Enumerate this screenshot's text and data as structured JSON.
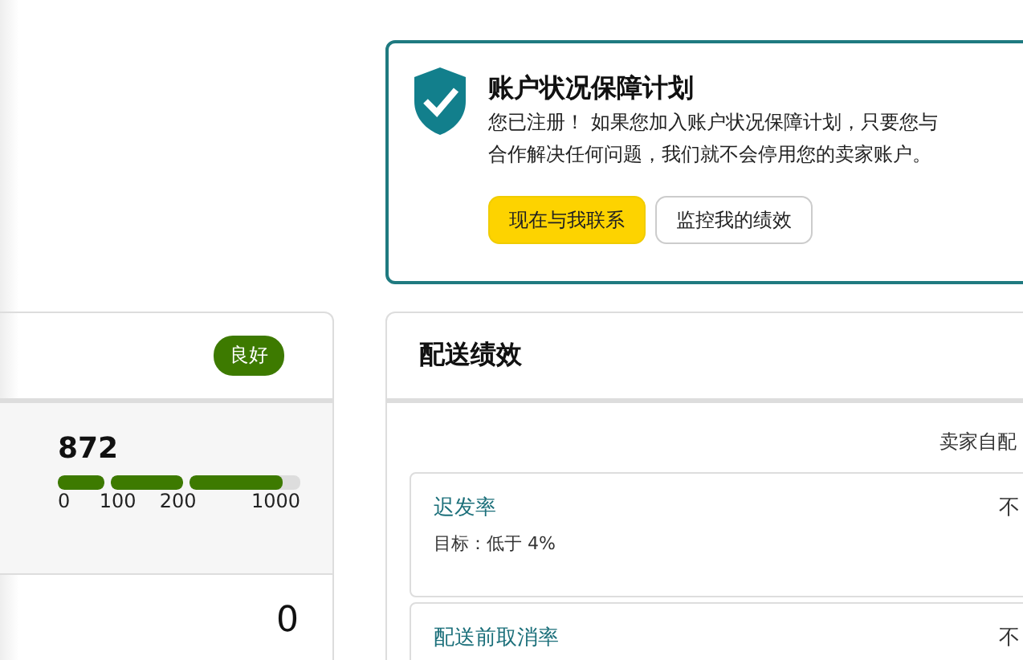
{
  "account_health_card": {
    "title": "账户状况保障计划",
    "message": "您已注册！ 如果您加入账户状况保障计划，只要您与",
    "message_line_2": "合作解决任何问题，我们就不会停用您的卖家账户。",
    "buttons": [
      {
        "label": "现在与我联系",
        "kind": "primary"
      },
      {
        "label": "监控我的绩效",
        "kind": "secondary"
      }
    ]
  },
  "rating_panel": {
    "status_badge": "良好",
    "score": "872",
    "segments": [
      {
        "level": 1
      },
      {
        "level": 1
      },
      {
        "level": 0.84
      }
    ],
    "ticks": [
      "0",
      "100",
      "200",
      "1000"
    ],
    "row_value": "0"
  },
  "shipping_performance": {
    "title": "配送绩效",
    "column_header": "卖家自配",
    "metrics": [
      {
        "name": "迟发率",
        "target": "目标：低于 4%",
        "value": "不"
      },
      {
        "name": "配送前取消率",
        "value": "不"
      }
    ]
  }
}
